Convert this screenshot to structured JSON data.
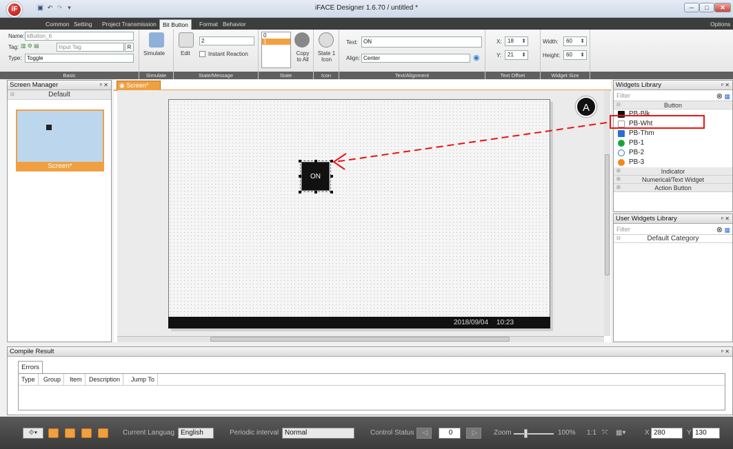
{
  "app": {
    "title": "iFACE Designer 1.6.70 / untitled *",
    "logo": "iF",
    "options": "Options"
  },
  "menu": {
    "tabs": [
      "Common",
      "Setting",
      "Project Transmission",
      "Bit Button",
      "Format",
      "Behavior"
    ],
    "active": "Bit Button"
  },
  "ribbon": {
    "basic": {
      "name_label": "Name:",
      "name_value": "kButton_6",
      "tag_label": "Tag:",
      "tag_value": "Input Tag",
      "tag_r": "R",
      "type_label": "Type:",
      "type_value": "Toggle",
      "group": "Basic"
    },
    "simulate": {
      "label": "Simulate",
      "group": "Simulate"
    },
    "state_message": {
      "edit": "Edit",
      "value": "2",
      "instant": "Instant Reaction",
      "group": "State/Message"
    },
    "state": {
      "value0": "0",
      "value1": "1",
      "copy": "Copy to All",
      "group": "State"
    },
    "icon": {
      "label": "State 1 Icon",
      "group": "Icon"
    },
    "text_alignment": {
      "text_label": "Text:",
      "text_value": "ON",
      "align_label": "Align:",
      "align_value": "Center",
      "group": "Text/Alignment"
    },
    "text_offset": {
      "x_label": "X:",
      "x_value": "18",
      "y_label": "Y:",
      "y_value": "21",
      "group": "Text Offset"
    },
    "widget_size": {
      "width_label": "Width:",
      "width_value": "60",
      "height_label": "Height:",
      "height_value": "60",
      "group": "Widget Size"
    }
  },
  "screen_manager": {
    "title": "Screen Manager",
    "category": "Default",
    "screen_name": "Screen*"
  },
  "editor": {
    "tab": "Screen*",
    "button_text": "ON",
    "date": "2018/09/04",
    "time": "10:23"
  },
  "widgets_library": {
    "title": "Widgets Library",
    "filter_placeholder": "Filter",
    "categories": {
      "button": "Button",
      "indicator": "Indicator",
      "numerical": "Numerical/Text Widget",
      "action": "Action Button"
    },
    "items": [
      {
        "label": "PB-Blk",
        "color": "#111111"
      },
      {
        "label": "PB-Wht",
        "color": "#ffffff"
      },
      {
        "label": "PB-Thm",
        "color": "#2a6fd6"
      },
      {
        "label": "PB-1",
        "color": "#1aa33a"
      },
      {
        "label": "PB-2",
        "color": "#ffffff"
      },
      {
        "label": "PB-3",
        "color": "#f08a1a"
      }
    ]
  },
  "user_widgets": {
    "title": "User Widgets Library",
    "filter_placeholder": "Filter",
    "category": "Default Category"
  },
  "annotation": {
    "badge": "A",
    "color": "#e11111"
  },
  "compile": {
    "title": "Compile Result",
    "tab": "Errors",
    "columns": [
      "Type",
      "Group",
      "Item",
      "Description",
      "Jump To"
    ]
  },
  "statusbar": {
    "lang_label": "Current Languag",
    "lang_value": "English",
    "periodic_label": "Periodic interval",
    "periodic_value": "Normal",
    "control_label": "Control Status",
    "control_value": "0",
    "zoom_label": "Zoom",
    "zoom_value": "100%",
    "ratio": "1:1",
    "x_label": "X",
    "x_value": "280",
    "y_label": "Y",
    "y_value": "130"
  }
}
